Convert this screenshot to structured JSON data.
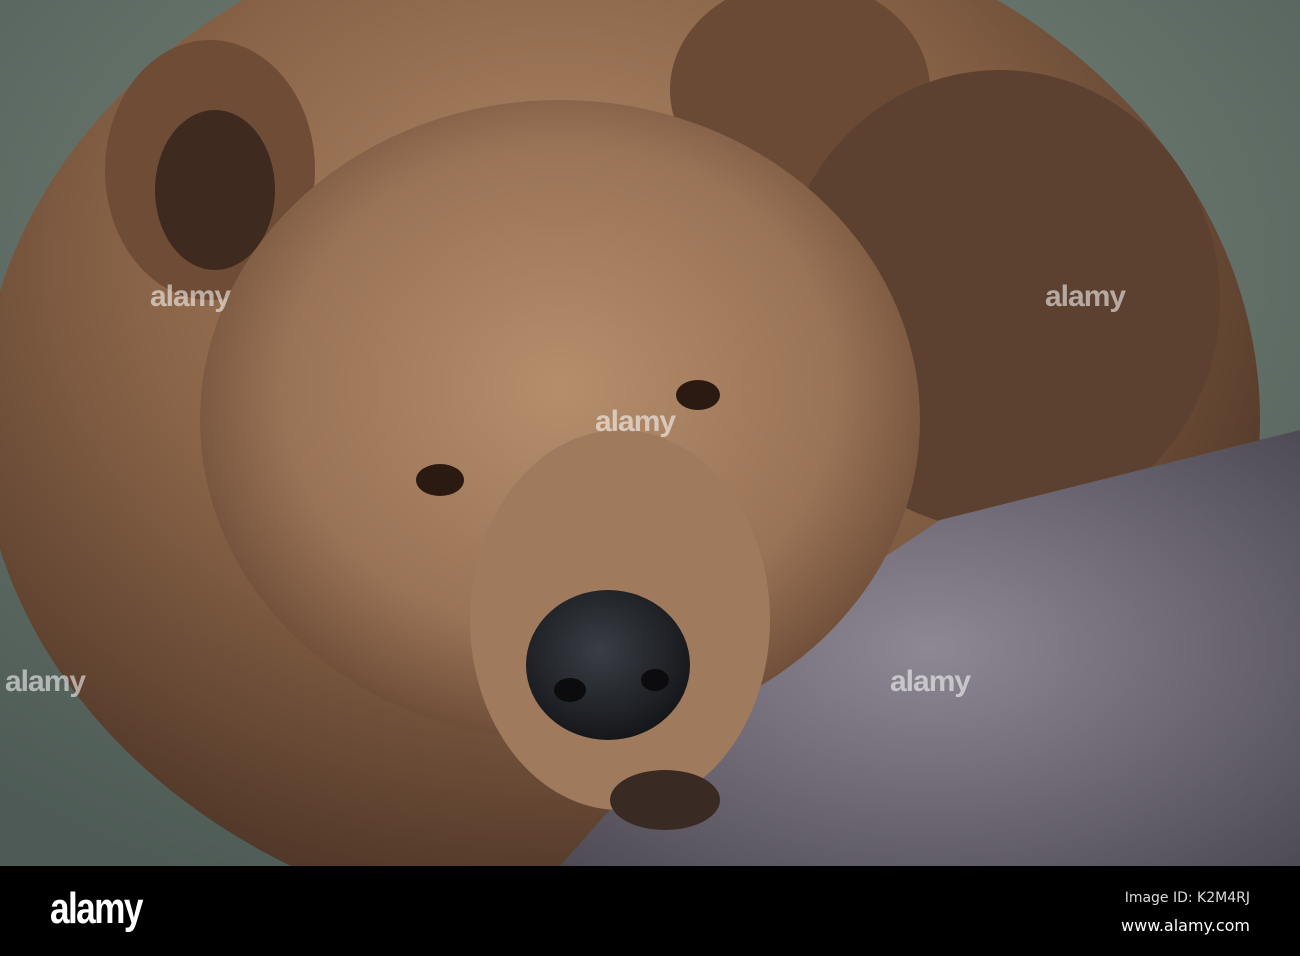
{
  "photo": {
    "subject": "brown-bear-resting-on-rock"
  },
  "watermark": {
    "text": "alamy"
  },
  "footer": {
    "logo": "alamy",
    "image_id": "Image ID: K2M4RJ",
    "website": "www.alamy.com"
  }
}
